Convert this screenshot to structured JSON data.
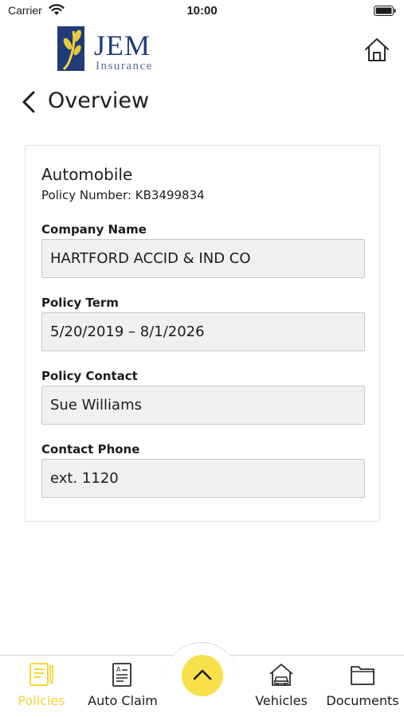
{
  "status_bar": {
    "carrier": "Carrier",
    "time": "10:00"
  },
  "header": {
    "logo_text": "JEM",
    "logo_subtext": "Insurance",
    "brand_color": "#1f3c78",
    "icons": [
      "home-icon",
      "chevron-left-icon"
    ]
  },
  "page": {
    "title": "Overview"
  },
  "policy": {
    "type": "Automobile",
    "number_label": "Policy Number:",
    "number": "KB3499834",
    "fields": [
      {
        "label": "Company Name",
        "value": "HARTFORD ACCID & IND CO"
      },
      {
        "label": "Policy Term",
        "value": "5/20/2019 – 8/1/2026"
      },
      {
        "label": "Policy Contact",
        "value": "Sue Williams"
      },
      {
        "label": "Contact Phone",
        "value": "ext. 1120"
      }
    ]
  },
  "tab_bar": {
    "accent_color": "#f8e04a",
    "tabs": [
      {
        "label": "Policies",
        "icon": "policies-icon",
        "active": true
      },
      {
        "label": "Auto Claim",
        "icon": "auto-claim-icon",
        "active": false
      },
      {
        "label": "Vehicles",
        "icon": "vehicles-icon",
        "active": false
      },
      {
        "label": "Documents",
        "icon": "documents-icon",
        "active": false
      }
    ],
    "center_button_icon": "chevron-up-icon"
  }
}
